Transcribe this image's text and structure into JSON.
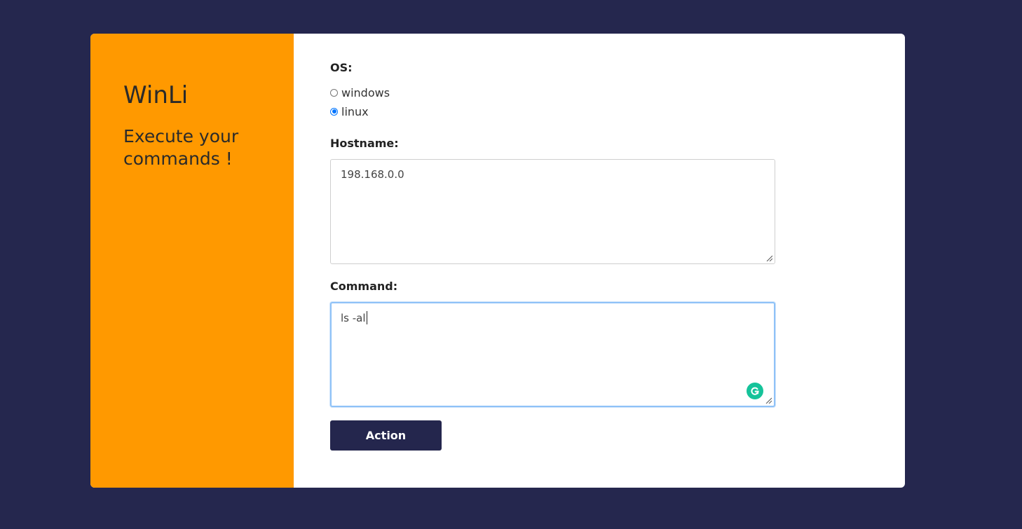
{
  "sidebar": {
    "brand": "WinLi",
    "tagline": "Execute your commands !"
  },
  "form": {
    "os_label": "OS:",
    "os_options": [
      {
        "label": "windows",
        "checked": false
      },
      {
        "label": "linux",
        "checked": true
      }
    ],
    "hostname_label": "Hostname:",
    "hostname_value": "198.168.0.0",
    "command_label": "Command:",
    "command_value": "ls -al",
    "action_label": "Action"
  },
  "icons": {
    "grammarly": "grammarly-icon",
    "resize": "resize-grip-icon"
  },
  "colors": {
    "page_bg": "#25274e",
    "sidebar_bg": "#ff9900",
    "button_bg": "#24264d",
    "radio_accent": "#0075ff",
    "focus_ring": "#8fc2f7",
    "grammarly_green": "#15c39a"
  }
}
